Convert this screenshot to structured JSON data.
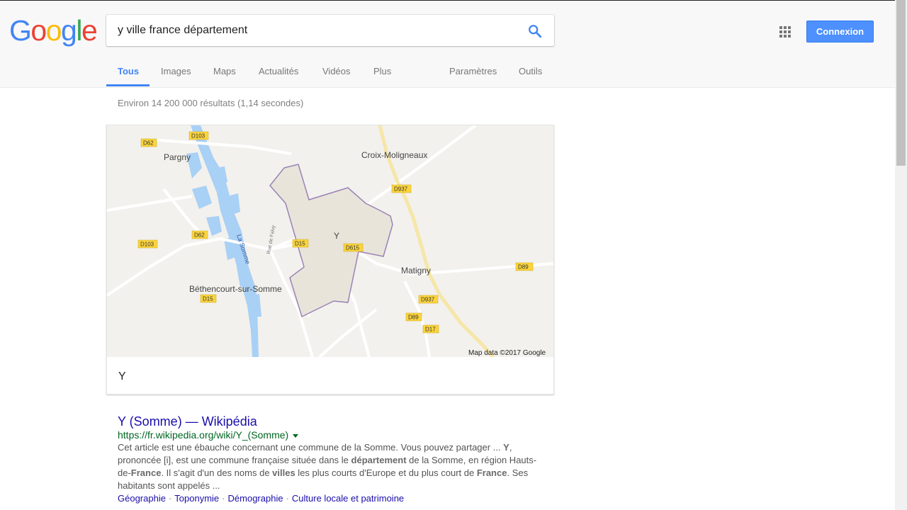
{
  "logo": {
    "letters": [
      "G",
      "o",
      "o",
      "g",
      "l",
      "e"
    ],
    "colors": [
      "#4285f4",
      "#ea4335",
      "#fbbc05",
      "#4285f4",
      "#34a853",
      "#ea4335"
    ]
  },
  "search": {
    "query": "y ville france département"
  },
  "header": {
    "signin_label": "Connexion"
  },
  "tabs": [
    {
      "label": "Tous",
      "active": true
    },
    {
      "label": "Images"
    },
    {
      "label": "Maps"
    },
    {
      "label": "Actualités"
    },
    {
      "label": "Vidéos"
    },
    {
      "label": "Plus"
    },
    {
      "label": "Paramètres"
    },
    {
      "label": "Outils"
    }
  ],
  "stats": "Environ 14 200 000 résultats (1,14 secondes)",
  "map": {
    "places": {
      "pargny": "Pargny",
      "croix": "Croix-Moligneaux",
      "y": "Y",
      "matigny": "Matigny",
      "bethencourt": "Béthencourt-sur-Somme",
      "somme": "La Somme",
      "rue_falvy": "Rue de Falvy"
    },
    "roads": {
      "d62a": "D62",
      "d103a": "D103",
      "d937a": "D937",
      "d62b": "D62",
      "d103b": "D103",
      "d15a": "D15",
      "d615": "D615",
      "d89a": "D89",
      "d15b": "D15",
      "d937b": "D937",
      "d89b": "D89",
      "d17": "D17"
    },
    "attribution": "Map data ©2017 Google",
    "caption": "Y",
    "colors": {
      "land": "#f2f1ed",
      "water": "#a9d0f5",
      "commune_fill": "#e8e4da",
      "commune_border": "#9b83b5",
      "road_shield": "#fbd43d"
    }
  },
  "result": {
    "title": "Y (Somme) — Wikipédia",
    "url": "https://fr.wikipedia.org/wiki/Y_(Somme)",
    "snippet": {
      "s1": "Cet article est une ébauche concernant une commune de la Somme. Vous pouvez partager ... ",
      "b1": "Y",
      "s2": ", prononcée [i], est une commune française située dans le ",
      "b2": "département",
      "s3": " de la Somme, en région Hauts-de-",
      "b3": "France",
      "s4": ". Il s'agit d'un des noms de ",
      "b4": "villes",
      "s5": " les plus courts d'Europe et du plus court de ",
      "b5": "France",
      "s6": ". Ses habitants sont appelés ..."
    },
    "sitelinks": [
      "Géographie",
      "Toponymie",
      "Démographie",
      "Culture locale et patrimoine"
    ]
  }
}
